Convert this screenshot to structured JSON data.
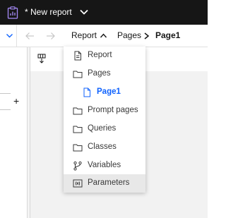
{
  "app": {
    "title": "* New report",
    "icon": "report-clipboard-icon"
  },
  "nav": {
    "breadcrumb": [
      {
        "label": "Report",
        "icon": "chevron-up-icon"
      },
      {
        "label": "Pages",
        "icon": "chevron-right-icon"
      },
      {
        "label": "Page1",
        "current": true
      }
    ]
  },
  "menu": {
    "items": [
      {
        "label": "Report",
        "icon": "document-icon"
      },
      {
        "label": "Pages",
        "icon": "folder-icon"
      },
      {
        "label": "Page1",
        "icon": "page-icon",
        "selected": true
      },
      {
        "label": "Prompt pages",
        "icon": "folder-icon"
      },
      {
        "label": "Queries",
        "icon": "folder-icon"
      },
      {
        "label": "Classes",
        "icon": "folder-icon"
      },
      {
        "label": "Variables",
        "icon": "branch-icon"
      },
      {
        "label": "Parameters",
        "icon": "parameter-icon",
        "hovered": true
      }
    ]
  },
  "left_panel": {
    "add_label": "+"
  },
  "colors": {
    "topbar": "#161616",
    "accent": "#0f62fe",
    "hover": "#e8e8e8",
    "canvas": "#f2f2f2"
  }
}
